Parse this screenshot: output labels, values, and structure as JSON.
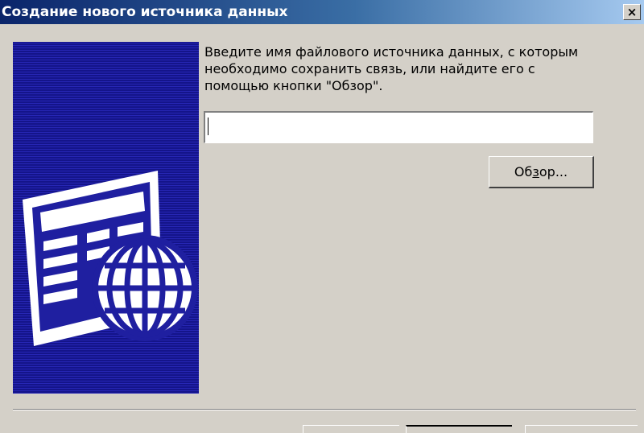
{
  "window": {
    "title": "Создание нового источника данных",
    "close_label": "×"
  },
  "instruction": {
    "lines": [
      "Введите имя файлового источника данных, с которым",
      "необходимо сохранить связь, или найдите его с",
      "помощью кнопки \"Обзор\"."
    ]
  },
  "filename_input": {
    "value": ""
  },
  "browse_button": {
    "label_prefix": "Об",
    "label_accel": "з",
    "label_suffix": "ор..."
  },
  "colors": {
    "panel_blue": "#1f1fa0",
    "dialog_gray": "#d4d0c8",
    "title_gradient_start": "#0a246a"
  }
}
